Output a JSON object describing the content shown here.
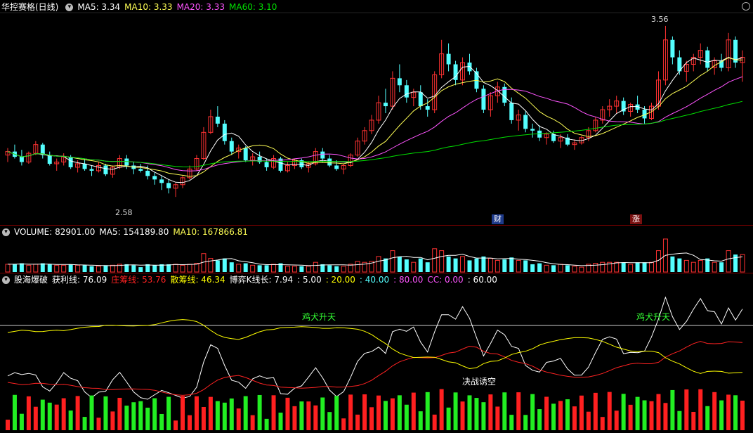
{
  "header_main": {
    "title": "华控赛格(日线)",
    "ma5": "MA5: 3.34",
    "ma10": "MA10: 3.33",
    "ma20": "MA20: 3.33",
    "ma60": "MA60: 3.10"
  },
  "header_volume": {
    "volume": "VOLUME: 82901.00",
    "ma5": "MA5: 154189.80",
    "ma10": "MA10: 167866.81"
  },
  "header_indicator": {
    "name": "股海爆破",
    "gain": "获利线: 76.09",
    "dealer": "庄筹线: 53.76",
    "retail": "散筹线: 46.34",
    "kline": "博弈K线长: 7.94",
    "v1": ": 5.00",
    "v2": ": 20.00",
    "v3": ": 40.00",
    "v4": ": 80.00",
    "cc": "CC: 0.00",
    "v5": ": 60.00"
  },
  "markers": {
    "finance": "财",
    "rise": "涨",
    "high_label": "3.56",
    "low_label": "2.58"
  },
  "annotations": {
    "a1": "鸡犬升天",
    "a2": "鸡犬升天",
    "a3": "决战诱空"
  },
  "colors": {
    "up": "#ff3232",
    "down": "#54ffff",
    "ma5": "#ffffff",
    "ma10": "#ffff55",
    "ma20": "#ff55ff",
    "ma60": "#00e000",
    "gain_line": "#ffffff",
    "dealer_line": "#ff2222",
    "retail_line": "#ffff00"
  },
  "chart_data": [
    {
      "type": "candlestick",
      "title": "华控赛格(日线)",
      "ylim": [
        2.5,
        3.62
      ],
      "high": 3.56,
      "low": 2.58,
      "ohlc": [
        [
          2.82,
          2.86,
          2.78,
          2.84
        ],
        [
          2.84,
          2.88,
          2.8,
          2.81
        ],
        [
          2.81,
          2.85,
          2.76,
          2.78
        ],
        [
          2.78,
          2.84,
          2.77,
          2.83
        ],
        [
          2.83,
          2.9,
          2.82,
          2.88
        ],
        [
          2.88,
          2.89,
          2.8,
          2.82
        ],
        [
          2.82,
          2.84,
          2.76,
          2.77
        ],
        [
          2.77,
          2.8,
          2.73,
          2.78
        ],
        [
          2.78,
          2.83,
          2.76,
          2.81
        ],
        [
          2.81,
          2.82,
          2.74,
          2.75
        ],
        [
          2.75,
          2.79,
          2.72,
          2.77
        ],
        [
          2.77,
          2.8,
          2.73,
          2.74
        ],
        [
          2.74,
          2.76,
          2.7,
          2.73
        ],
        [
          2.73,
          2.78,
          2.72,
          2.76
        ],
        [
          2.76,
          2.77,
          2.7,
          2.71
        ],
        [
          2.71,
          2.76,
          2.69,
          2.75
        ],
        [
          2.75,
          2.82,
          2.74,
          2.8
        ],
        [
          2.8,
          2.82,
          2.74,
          2.76
        ],
        [
          2.76,
          2.78,
          2.71,
          2.74
        ],
        [
          2.74,
          2.77,
          2.72,
          2.73
        ],
        [
          2.73,
          2.76,
          2.68,
          2.7
        ],
        [
          2.7,
          2.72,
          2.65,
          2.68
        ],
        [
          2.68,
          2.7,
          2.62,
          2.66
        ],
        [
          2.66,
          2.68,
          2.6,
          2.63
        ],
        [
          2.63,
          2.66,
          2.58,
          2.65
        ],
        [
          2.65,
          2.7,
          2.63,
          2.69
        ],
        [
          2.69,
          2.76,
          2.68,
          2.74
        ],
        [
          2.74,
          2.82,
          2.73,
          2.8
        ],
        [
          2.8,
          2.98,
          2.79,
          2.95
        ],
        [
          2.95,
          3.08,
          2.94,
          3.04
        ],
        [
          3.04,
          3.1,
          2.98,
          3.0
        ],
        [
          3.0,
          3.02,
          2.88,
          2.9
        ],
        [
          2.9,
          2.92,
          2.82,
          2.84
        ],
        [
          2.84,
          2.88,
          2.8,
          2.86
        ],
        [
          2.86,
          2.87,
          2.78,
          2.79
        ],
        [
          2.79,
          2.83,
          2.76,
          2.81
        ],
        [
          2.81,
          2.84,
          2.77,
          2.78
        ],
        [
          2.78,
          2.8,
          2.73,
          2.75
        ],
        [
          2.75,
          2.82,
          2.74,
          2.8
        ],
        [
          2.8,
          2.81,
          2.72,
          2.73
        ],
        [
          2.73,
          2.78,
          2.72,
          2.76
        ],
        [
          2.76,
          2.8,
          2.74,
          2.79
        ],
        [
          2.79,
          2.8,
          2.74,
          2.75
        ],
        [
          2.75,
          2.78,
          2.72,
          2.77
        ],
        [
          2.77,
          2.86,
          2.76,
          2.84
        ],
        [
          2.84,
          2.86,
          2.78,
          2.8
        ],
        [
          2.8,
          2.82,
          2.75,
          2.76
        ],
        [
          2.76,
          2.79,
          2.73,
          2.74
        ],
        [
          2.74,
          2.77,
          2.71,
          2.76
        ],
        [
          2.76,
          2.83,
          2.75,
          2.82
        ],
        [
          2.82,
          2.92,
          2.81,
          2.9
        ],
        [
          2.9,
          2.98,
          2.88,
          2.96
        ],
        [
          2.96,
          3.05,
          2.94,
          3.02
        ],
        [
          3.02,
          3.16,
          3.0,
          3.12
        ],
        [
          3.12,
          3.2,
          3.06,
          3.1
        ],
        [
          3.1,
          3.3,
          3.08,
          3.26
        ],
        [
          3.26,
          3.34,
          3.18,
          3.22
        ],
        [
          3.22,
          3.25,
          3.12,
          3.15
        ],
        [
          3.15,
          3.2,
          3.1,
          3.18
        ],
        [
          3.18,
          3.22,
          3.08,
          3.1
        ],
        [
          3.1,
          3.14,
          3.04,
          3.08
        ],
        [
          3.08,
          3.3,
          3.06,
          3.28
        ],
        [
          3.28,
          3.48,
          3.26,
          3.4
        ],
        [
          3.4,
          3.46,
          3.3,
          3.34
        ],
        [
          3.34,
          3.36,
          3.22,
          3.25
        ],
        [
          3.25,
          3.38,
          3.22,
          3.35
        ],
        [
          3.35,
          3.4,
          3.28,
          3.3
        ],
        [
          3.3,
          3.32,
          3.18,
          3.2
        ],
        [
          3.2,
          3.22,
          3.06,
          3.08
        ],
        [
          3.08,
          3.18,
          3.04,
          3.16
        ],
        [
          3.16,
          3.24,
          3.12,
          3.21
        ],
        [
          3.21,
          3.23,
          3.1,
          3.12
        ],
        [
          3.12,
          3.15,
          3.0,
          3.02
        ],
        [
          3.02,
          3.08,
          2.96,
          3.05
        ],
        [
          3.05,
          3.07,
          2.95,
          2.97
        ],
        [
          2.97,
          3.0,
          2.92,
          2.96
        ],
        [
          2.96,
          2.99,
          2.9,
          2.92
        ],
        [
          2.92,
          2.95,
          2.88,
          2.94
        ],
        [
          2.94,
          2.96,
          2.89,
          2.9
        ],
        [
          2.9,
          2.94,
          2.86,
          2.92
        ],
        [
          2.92,
          2.94,
          2.87,
          2.88
        ],
        [
          2.88,
          2.91,
          2.85,
          2.89
        ],
        [
          2.89,
          2.93,
          2.88,
          2.92
        ],
        [
          2.92,
          2.98,
          2.9,
          2.96
        ],
        [
          2.96,
          3.04,
          2.95,
          3.02
        ],
        [
          3.02,
          3.1,
          3.0,
          3.08
        ],
        [
          3.08,
          3.14,
          3.04,
          3.1
        ],
        [
          3.1,
          3.16,
          3.06,
          3.13
        ],
        [
          3.13,
          3.15,
          3.05,
          3.07
        ],
        [
          3.07,
          3.12,
          3.04,
          3.11
        ],
        [
          3.11,
          3.16,
          3.06,
          3.08
        ],
        [
          3.08,
          3.1,
          3.0,
          3.03
        ],
        [
          3.03,
          3.12,
          3.02,
          3.1
        ],
        [
          3.1,
          3.3,
          3.08,
          3.25
        ],
        [
          3.25,
          3.56,
          3.22,
          3.48
        ],
        [
          3.48,
          3.5,
          3.34,
          3.38
        ],
        [
          3.38,
          3.42,
          3.28,
          3.3
        ],
        [
          3.3,
          3.36,
          3.24,
          3.34
        ],
        [
          3.34,
          3.4,
          3.3,
          3.38
        ],
        [
          3.38,
          3.46,
          3.34,
          3.42
        ],
        [
          3.42,
          3.44,
          3.3,
          3.32
        ],
        [
          3.32,
          3.38,
          3.28,
          3.36
        ],
        [
          3.36,
          3.4,
          3.3,
          3.32
        ],
        [
          3.32,
          3.52,
          3.3,
          3.48
        ],
        [
          3.48,
          3.5,
          3.32,
          3.35
        ],
        [
          3.35,
          3.42,
          3.24,
          3.38
        ]
      ]
    },
    {
      "type": "bar",
      "title": "VOLUME",
      "volume": 82901.0,
      "ma5": 154189.8,
      "ma10": 167866.81
    },
    {
      "type": "line",
      "title": "股海爆破",
      "gain_line": 76.09,
      "dealer_line": 53.76,
      "retail_line": 46.34,
      "kline_length": 7.94,
      "reference_levels": [
        5.0,
        20.0,
        40.0,
        80.0,
        60.0
      ],
      "cc": 0.0
    }
  ]
}
